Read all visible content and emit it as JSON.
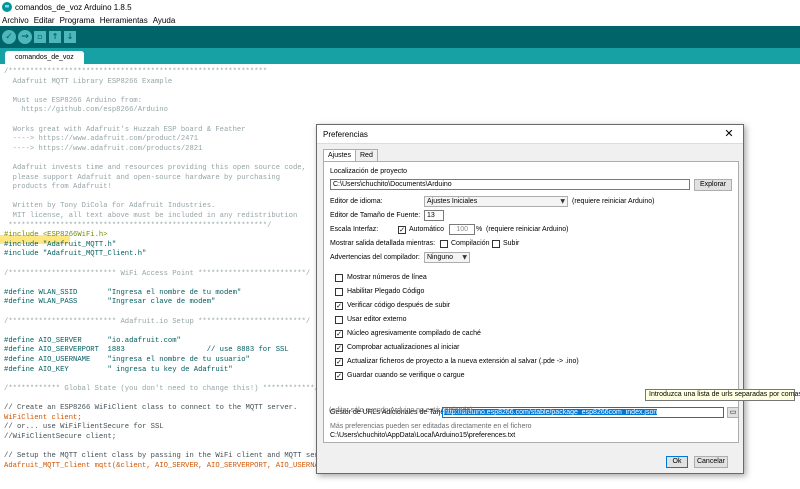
{
  "window": {
    "title": "comandos_de_voz Arduino 1.8.5",
    "logo_text": "∞"
  },
  "menu": [
    "Archivo",
    "Editar",
    "Programa",
    "Herramientas",
    "Ayuda"
  ],
  "toolbar": {
    "verify_icon": "check-icon",
    "verify_glyph": "✓",
    "upload_icon": "right-arrow-icon",
    "upload_glyph": "→",
    "new_icon": "new-file-icon",
    "new_glyph": "▫",
    "open_icon": "up-arrow-icon",
    "open_glyph": "↑",
    "save_icon": "down-arrow-icon",
    "save_glyph": "↓"
  },
  "tab": {
    "label": "comandos_de_voz"
  },
  "code": [
    {
      "t": "/************************************************************",
      "c": "cmt"
    },
    {
      "t": "  Adafruit MQTT Library ESP8266 Example",
      "c": "cmt"
    },
    {
      "t": "",
      "c": "cmt"
    },
    {
      "t": "  Must use ESP8266 Arduino from:",
      "c": "cmt"
    },
    {
      "t": "    https://github.com/esp8266/Arduino",
      "c": "cmt"
    },
    {
      "t": "",
      "c": "cmt"
    },
    {
      "t": "  Works great with Adafruit's Huzzah ESP board & Feather",
      "c": "cmt"
    },
    {
      "t": "  ----> https://www.adafruit.com/product/2471",
      "c": "cmt"
    },
    {
      "t": "  ----> https://www.adafruit.com/products/2821",
      "c": "cmt"
    },
    {
      "t": "",
      "c": "cmt"
    },
    {
      "t": "  Adafruit invests time and resources providing this open source code,",
      "c": "cmt"
    },
    {
      "t": "  please support Adafruit and open-source hardware by purchasing",
      "c": "cmt"
    },
    {
      "t": "  products from Adafruit!",
      "c": "cmt"
    },
    {
      "t": "",
      "c": "cmt"
    },
    {
      "t": "  Written by Tony DiCola for Adafruit Industries.",
      "c": "cmt"
    },
    {
      "t": "  MIT license, all text above must be included in any redistribution",
      "c": "cmt"
    },
    {
      "t": " ************************************************************/",
      "c": "cmt"
    },
    {
      "t": "#include <ESP8266WiFi.h>",
      "c": "kw"
    },
    {
      "t": "#include \"Adafruit_MQTT.h\"",
      "c": "str"
    },
    {
      "t": "#include \"Adafruit_MQTT_Client.h\"",
      "c": "str"
    },
    {
      "t": "",
      "c": "cmt"
    },
    {
      "t": "/************************* WiFi Access Point *************************/",
      "c": "cmt"
    },
    {
      "t": "",
      "c": "cmt"
    },
    {
      "t": "#define WLAN_SSID       \"Ingresa el nombre de tu modem\"",
      "c": "str"
    },
    {
      "t": "#define WLAN_PASS       \"Ingresar clave de modem\"",
      "c": "str"
    },
    {
      "t": "",
      "c": "cmt"
    },
    {
      "t": "/************************* Adafruit.io Setup *************************/",
      "c": "cmt"
    },
    {
      "t": "",
      "c": "cmt"
    },
    {
      "t": "#define AIO_SERVER      \"io.adafruit.com\"",
      "c": "str"
    },
    {
      "t": "#define AIO_SERVERPORT  1883                   // use 8883 for SSL",
      "c": "str"
    },
    {
      "t": "#define AIO_USERNAME    \"ingresa el nombre de tu usuario\"",
      "c": "str"
    },
    {
      "t": "#define AIO_KEY         \" ingresa tu key de Adafruit\"",
      "c": "str"
    },
    {
      "t": "",
      "c": "cmt"
    },
    {
      "t": "/************ Global State (you don't need to change this!) ************/",
      "c": "cmt"
    },
    {
      "t": "",
      "c": "cmt"
    },
    {
      "t": "// Create an ESP8266 WiFiClient class to connect to the MQTT server.",
      "c": "plain"
    },
    {
      "t": "WiFiClient client;",
      "c": "org"
    },
    {
      "t": "// or... use WiFiFlientSecure for SSL",
      "c": "plain"
    },
    {
      "t": "//WiFiClientSecure client;",
      "c": "plain"
    },
    {
      "t": "",
      "c": "cmt"
    },
    {
      "t": "// Setup the MQTT client class by passing in the WiFi client and MQTT server and login details.",
      "c": "plain"
    },
    {
      "t": "Adafruit_MQTT_Client mqtt(&client, AIO_SERVER, AIO_SERVERPORT, AIO_USERNAME, AIO_KEY);",
      "c": "org"
    }
  ],
  "prefs": {
    "title": "Preferencias",
    "close_glyph": "✕",
    "tab_settings": "Ajustes",
    "tab_network": "Red",
    "sketchbook_label": "Localización de proyecto",
    "sketchbook_path": "C:\\Users\\chuchito\\Documents\\Arduino",
    "browse_label": "Explorar",
    "language_label": "Editor de idioma:",
    "language_value": "Ajustes Iniciales",
    "language_note": "(requiere reiniciar Arduino)",
    "font_size_label": "Editor de Tamaño de Fuente:",
    "font_size_value": "13",
    "scale_label": "Escala Interfaz:",
    "scale_auto_label": "Automático",
    "scale_value": "100",
    "scale_unit": "%",
    "scale_note": "(requiere reiniciar Arduino)",
    "verbose_label": "Mostrar salida detallada mientras:",
    "verbose_compile": "Compilación",
    "verbose_upload": "Subir",
    "warnings_label": "Advertencias del compilador:",
    "warnings_value": "Ninguno",
    "options": [
      {
        "label": "Mostrar números de línea",
        "checked": false
      },
      {
        "label": "Habilitar Plegado Código",
        "checked": false
      },
      {
        "label": "Verificar código después de subir",
        "checked": true
      },
      {
        "label": "Usar editor externo",
        "checked": false
      },
      {
        "label": "Núcleo agresivamente compilado de caché",
        "checked": true
      },
      {
        "label": "Comprobar actualizaciones al iniciar",
        "checked": true
      },
      {
        "label": "Actualizar ficheros de proyecto a la nueva extensión al salvar (.pde -> .ino)",
        "checked": true
      },
      {
        "label": "Guardar cuando se verifique o cargue",
        "checked": true
      }
    ],
    "boards_url_label": "Gestor de URLs Adicionales de Tarjetas:",
    "boards_url": "http://arduino.esp8266.com/stable/package_esp8266com_index.json",
    "more_prefs_note": "Más preferencias pueden ser editadas directamente en el fichero",
    "prefs_path": "C:\\Users\\chuchito\\AppData\\Local\\Arduino15\\preferences.txt",
    "edit_note": "(editar sólo cuando Arduino no está corriendo)",
    "ok_label": "Ok",
    "cancel_label": "Cancelar",
    "check_glyph": "✓",
    "url_button_glyph": "▭",
    "tooltip": "Introduzca una lista de urls separadas por comas"
  },
  "colors": {
    "toolbar": "#006468",
    "tabbar": "#17a1a5",
    "comment": "#95a5a6",
    "keyword": "#728e00",
    "string": "#005c5f",
    "highlight": "#ffdd57",
    "selection": "#0078d7"
  }
}
